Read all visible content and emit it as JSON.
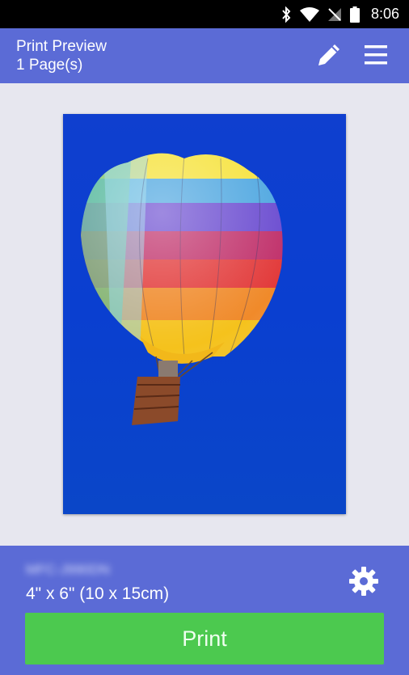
{
  "status_bar": {
    "time": "8:06",
    "icons": [
      "bluetooth-icon",
      "wifi-icon",
      "no-signal-icon",
      "battery-icon"
    ]
  },
  "header": {
    "title": "Print Preview",
    "subtitle": "1 Page(s)",
    "icons": [
      "pencil-icon",
      "hamburger-menu-icon"
    ]
  },
  "preview": {
    "image": "hot-air-balloon",
    "background_color": "#0a3fd0"
  },
  "settings_panel": {
    "printer_name": "MFC-J990DN",
    "paper_size": "4\" x 6\" (10 x 15cm)",
    "print_label": "Print"
  },
  "colors": {
    "status_bar": "#000000",
    "accent": "#5b6bd6",
    "print_button": "#4cc94f",
    "background": "#e7e7ef"
  }
}
